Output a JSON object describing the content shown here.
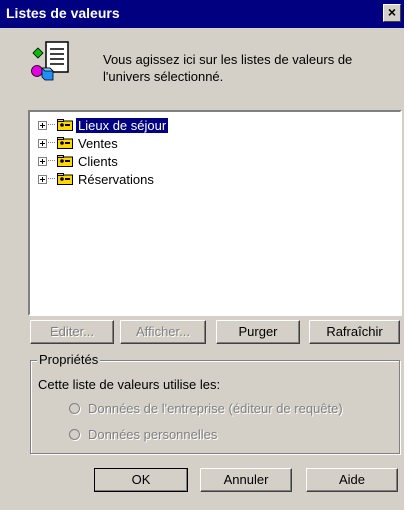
{
  "window": {
    "title": "Listes de valeurs",
    "close_label": "×"
  },
  "description": "Vous agissez ici sur les listes de valeurs de\nl'univers sélectionné.",
  "tree": {
    "items": [
      {
        "label": "Lieux de séjour",
        "selected": true
      },
      {
        "label": "Ventes",
        "selected": false
      },
      {
        "label": "Clients",
        "selected": false
      },
      {
        "label": "Réservations",
        "selected": false
      }
    ]
  },
  "actions": {
    "edit": "Editer...",
    "show": "Afficher...",
    "purge": "Purger",
    "refresh": "Rafraîchir"
  },
  "properties": {
    "title": "Propriétés",
    "subtitle": "Cette liste de valeurs utilise les:",
    "option_enterprise": "Données de l'entreprise (éditeur de requête)",
    "option_personal": "Données personnelles"
  },
  "footer": {
    "ok": "OK",
    "cancel": "Annuler",
    "help": "Aide"
  }
}
